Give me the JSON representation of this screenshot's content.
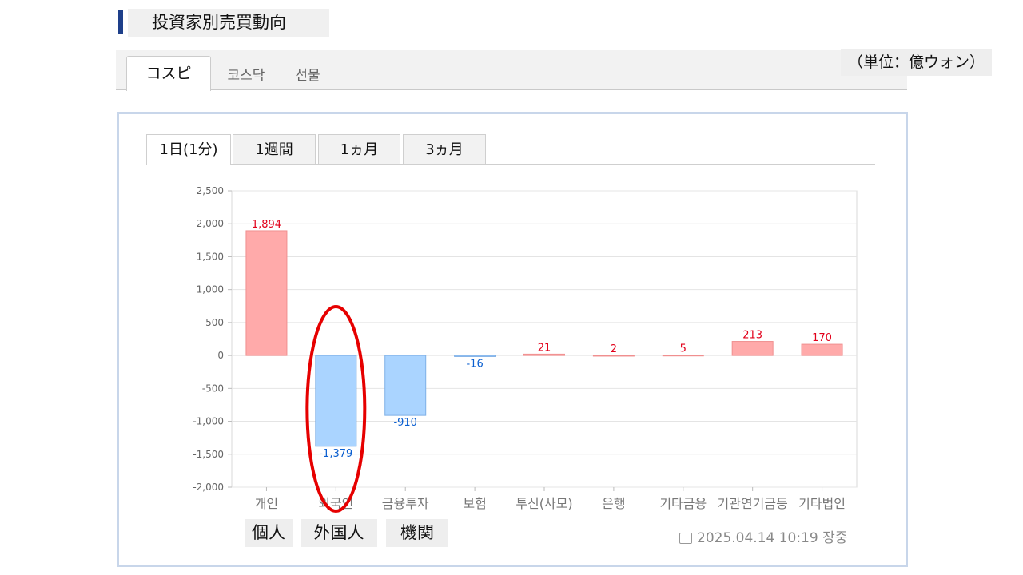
{
  "page_title": "投資家別売買動向",
  "market_tabs": [
    {
      "label": "コスピ",
      "active": true
    },
    {
      "label": "코스닥",
      "active": false
    },
    {
      "label": "선물",
      "active": false
    }
  ],
  "unit_label": "（単位：億ウォン）",
  "period_tabs": [
    {
      "label": "1日(1分)",
      "active": true
    },
    {
      "label": "1週間",
      "active": false
    },
    {
      "label": "1ヵ月",
      "active": false
    },
    {
      "label": "3ヵ月",
      "active": false
    }
  ],
  "jp_labels": [
    "個人",
    "外国人",
    "機関"
  ],
  "timestamp": "2025.04.14 10:19 장중",
  "colors": {
    "positive_fill": "#ffaaaa",
    "positive_stroke": "#f08f8f",
    "negative_fill": "#aad4ff",
    "negative_stroke": "#7fb0e6",
    "positive_text": "#e2001a",
    "negative_text": "#0b5fd0",
    "highlight": "#e60000",
    "title_accent": "#1e3f8a"
  },
  "chart_data": {
    "type": "bar",
    "categories": [
      "개인",
      "외국인",
      "금융투자",
      "보험",
      "투신(사모)",
      "은행",
      "기타금융",
      "기관연기금등",
      "기타법인"
    ],
    "values": [
      1894,
      -1379,
      -910,
      -16,
      21,
      2,
      5,
      213,
      170
    ],
    "data_labels": [
      "1,894",
      "-1,379",
      "-910",
      "-16",
      "21",
      "2",
      "5",
      "213",
      "170"
    ],
    "ylim": [
      -2000,
      2500
    ],
    "yticks": [
      2500,
      2000,
      1500,
      1000,
      500,
      0,
      -500,
      -1000,
      -1500,
      -2000
    ],
    "ytick_labels": [
      "2,500",
      "2,000",
      "1,500",
      "1,000",
      "500",
      "0",
      "-500",
      "-1,000",
      "-1,500",
      "-2,000"
    ],
    "grid": true,
    "highlighted_category": "외국인",
    "title": "",
    "xlabel": "",
    "ylabel": ""
  }
}
